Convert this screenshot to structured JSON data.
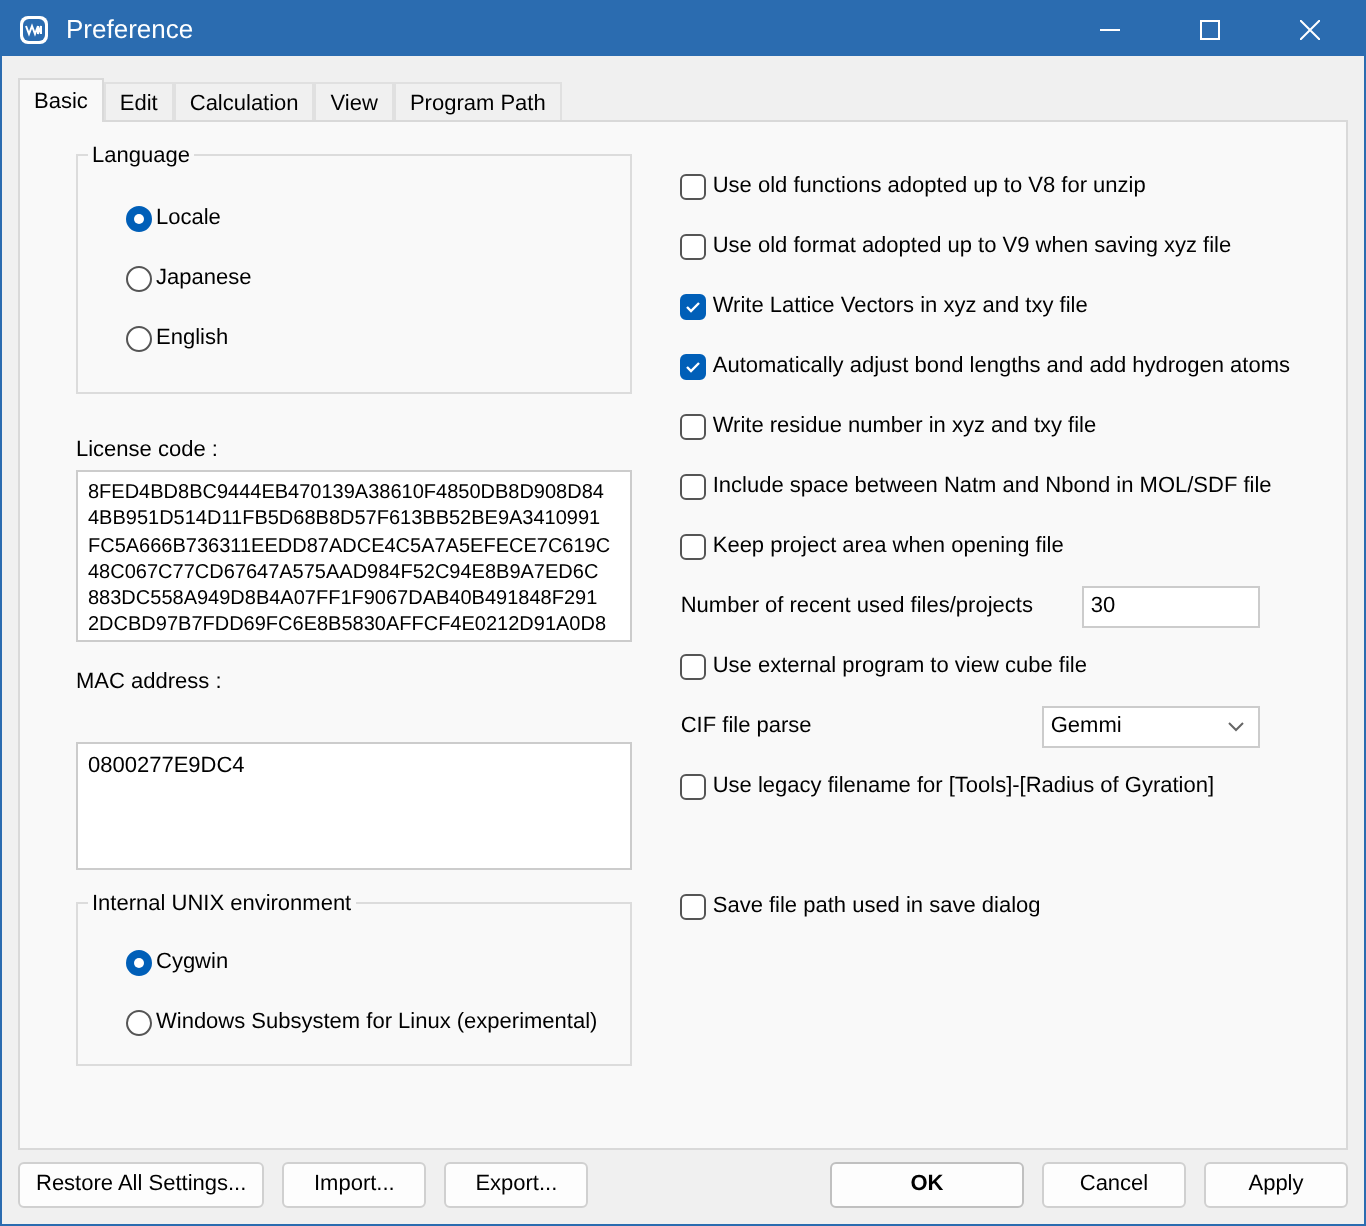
{
  "window": {
    "title": "Preference"
  },
  "tabs": [
    {
      "label": "Basic",
      "selected": true
    },
    {
      "label": "Edit",
      "selected": false
    },
    {
      "label": "Calculation",
      "selected": false
    },
    {
      "label": "View",
      "selected": false
    },
    {
      "label": "Program Path",
      "selected": false
    }
  ],
  "language": {
    "title": "Language",
    "options": [
      {
        "label": "Locale",
        "selected": true
      },
      {
        "label": "Japanese",
        "selected": false
      },
      {
        "label": "English",
        "selected": false
      }
    ]
  },
  "license": {
    "label": "License code :",
    "value": "8FED4BD8BC9444EB470139A38610F4850DB8D908D84\n4BB951D514D11FB5D68B8D57F613BB52BE9A3410991\nFC5A666B736311EEDD87ADCE4C5A7A5EFECE7C619C\n48C067C77CD67647A575AAD984F52C94E8B9A7ED6C\n883DC558A949D8B4A07FF1F9067DAB40B491848F291\n2DCBD97B7FDD69FC6E8B5830AFFCF4E0212D91A0D8"
  },
  "mac": {
    "label": "MAC address :",
    "value": "0800277E9DC4"
  },
  "unix": {
    "title": "Internal UNIX environment",
    "options": [
      {
        "label": "Cygwin",
        "selected": true
      },
      {
        "label": "Windows Subsystem for Linux (experimental)",
        "selected": false
      }
    ]
  },
  "options": [
    {
      "kind": "checkbox",
      "label": "Use old functions adopted up to V8 for unzip",
      "checked": false
    },
    {
      "kind": "checkbox",
      "label": "Use old format adopted up to V9 when saving xyz file",
      "checked": false
    },
    {
      "kind": "checkbox",
      "label": "Write Lattice Vectors in xyz and txy file",
      "checked": true
    },
    {
      "kind": "checkbox",
      "label": "Automatically adjust bond lengths and add hydrogen atoms",
      "checked": true
    },
    {
      "kind": "checkbox",
      "label": "Write residue number in xyz and txy file",
      "checked": false
    },
    {
      "kind": "checkbox",
      "label": "Include space between Natm and Nbond in MOL/SDF file",
      "checked": false
    },
    {
      "kind": "checkbox",
      "label": "Keep project area when opening file",
      "checked": false
    },
    {
      "kind": "number",
      "label": "Number of recent used files/projects",
      "value": "30"
    },
    {
      "kind": "checkbox",
      "label": "Use external program to view cube file",
      "checked": false
    },
    {
      "kind": "select",
      "label": "CIF file parse",
      "value": "Gemmi"
    },
    {
      "kind": "checkbox",
      "label": "Use legacy filename for [Tools]-[Radius of Gyration]",
      "checked": false
    },
    {
      "kind": "checkbox",
      "label": "Save file path used in save dialog",
      "checked": false
    }
  ],
  "left_buttons": [
    "Restore All Settings...",
    "Import...",
    "Export..."
  ],
  "right_buttons": [
    {
      "label": "OK",
      "default": true
    },
    {
      "label": "Cancel",
      "default": false
    },
    {
      "label": "Apply",
      "default": false
    }
  ]
}
